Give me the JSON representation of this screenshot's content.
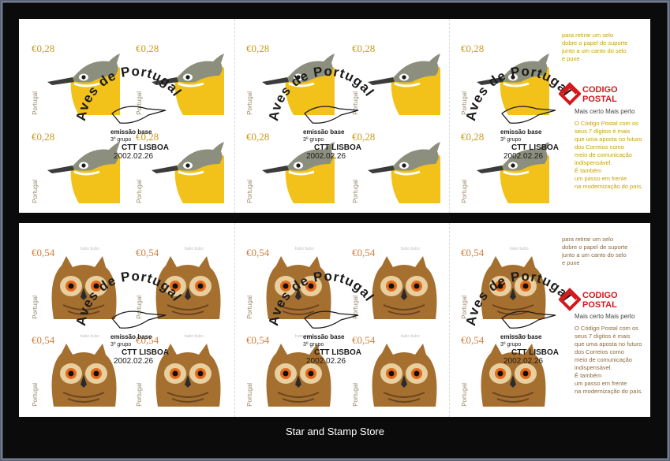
{
  "caption": "Star and Stamp Store",
  "postmark": {
    "arc_text": "Aves de Portugal",
    "line1": "emissão base",
    "line2": "3º grupo",
    "line3": "CTT LISBOA",
    "date": "2002.02.26"
  },
  "sheet1": {
    "value": "€0,28",
    "country": "Portugal",
    "info_top": [
      "para retirar um selo",
      "dobre o papel de suporte",
      "junto a um canto do selo",
      "e puxe"
    ],
    "logo_line1": "CODIGO",
    "logo_line2": "POSTAL",
    "tagline": "Mais certo Mais perto",
    "body": [
      "O Código Postal com os",
      "seus 7 dígitos é mais",
      "que uma aposta no futuro",
      "dos Correios como",
      "meio de comunicação",
      "indispensável.",
      "É também",
      "um passo em frente",
      "na modernização do país."
    ]
  },
  "sheet2": {
    "value": "€0,54",
    "country": "Portugal",
    "sci_label": "bubo bubo",
    "info_top": [
      "para retirar um selo",
      "dobre o papel de suporte",
      "junto a um canto do selo",
      "e puxe"
    ],
    "logo_line1": "CODIGO",
    "logo_line2": "POSTAL",
    "tagline": "Mais certo Mais perto",
    "body": [
      "O Código Postal com os",
      "seus 7 dígitos é mais",
      "que uma aposta no futuro",
      "dos Correios como",
      "meio de comunicação",
      "indispensável.",
      "É também",
      "um passo em frente",
      "na modernização do país."
    ]
  },
  "colors": {
    "bird_yellow": "#f2c21a",
    "bird_grey": "#8c8f7e",
    "owl_brown": "#a56f2f",
    "owl_eye": "#e56a1a",
    "logo_red": "#d3191c",
    "info_gold": "#c8a100"
  }
}
